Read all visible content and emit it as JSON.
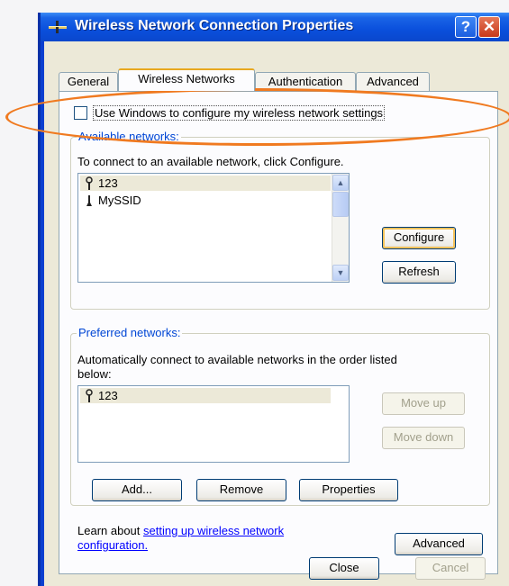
{
  "window": {
    "title": "Wireless Network Connection Properties",
    "help_button": "?",
    "close_button": "✕"
  },
  "tabs": [
    {
      "label": "General"
    },
    {
      "label": "Wireless Networks"
    },
    {
      "label": "Authentication"
    },
    {
      "label": "Advanced"
    }
  ],
  "use_windows_checkbox": {
    "label": "Use Windows to configure my wireless network settings",
    "checked": false
  },
  "available_networks": {
    "legend": "Available networks:",
    "instruction": "To connect to an available network, click Configure.",
    "items": [
      {
        "name": "123",
        "icon": "antenna-icon",
        "selected": true
      },
      {
        "name": "MySSID",
        "icon": "ad-hoc-icon",
        "selected": false
      }
    ],
    "configure_button": "Configure",
    "refresh_button": "Refresh"
  },
  "preferred_networks": {
    "legend": "Preferred networks:",
    "instruction_line1": "Automatically connect to available networks in the order listed",
    "instruction_line2": "below:",
    "items": [
      {
        "name": "123",
        "icon": "antenna-icon",
        "selected": true
      }
    ],
    "move_up_button": "Move up",
    "move_down_button": "Move down",
    "add_button": "Add...",
    "remove_button": "Remove",
    "properties_button": "Properties"
  },
  "learn_about": {
    "prefix": "Learn about ",
    "link_line1": "setting up wireless network",
    "link_line2": "configuration."
  },
  "advanced_button": "Advanced",
  "footer": {
    "close_button": "Close",
    "cancel_button": "Cancel"
  },
  "colors": {
    "highlight": "#f07a20",
    "titlebar": "#0a4fdc",
    "legend": "#0046d5"
  }
}
